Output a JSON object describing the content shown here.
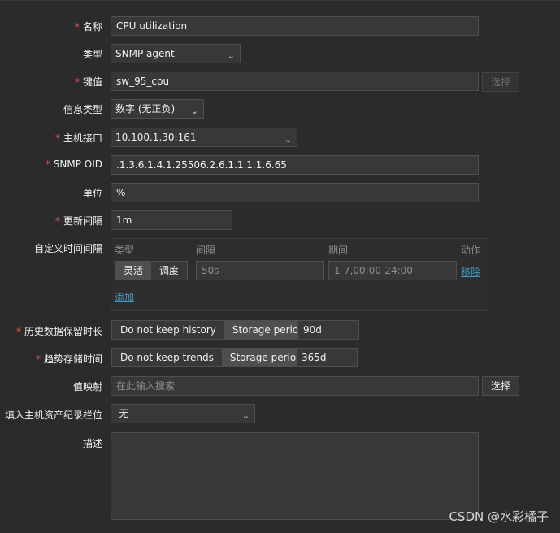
{
  "form": {
    "name": {
      "label": "名称",
      "value": "CPU utilization",
      "required": true
    },
    "type": {
      "label": "类型",
      "value": "SNMP agent"
    },
    "key": {
      "label": "键值",
      "value": "sw_95_cpu",
      "button": "选择",
      "required": true
    },
    "info_type": {
      "label": "信息类型",
      "value": "数字 (无正负)"
    },
    "host_interface": {
      "label": "主机接口",
      "value": "10.100.1.30:161",
      "required": true
    },
    "snmp_oid": {
      "label": "SNMP OID",
      "value": ".1.3.6.1.4.1.25506.2.6.1.1.1.1.6.65",
      "required": true
    },
    "units": {
      "label": "单位",
      "value": "%"
    },
    "update_interval": {
      "label": "更新间隔",
      "value": "1m",
      "required": true
    },
    "custom_intervals": {
      "label": "自定义时间间隔",
      "headers": {
        "type": "类型",
        "interval": "间隔",
        "period": "期间",
        "action": "动作"
      },
      "type_options": [
        "灵活",
        "调度"
      ],
      "interval_placeholder": "50s",
      "period_placeholder": "1-7,00:00-24:00",
      "remove": "移除",
      "add": "添加"
    },
    "history": {
      "label": "历史数据保留时长",
      "options": [
        "Do not keep history",
        "Storage period"
      ],
      "value": "90d",
      "required": true
    },
    "trends": {
      "label": "趋势存储时间",
      "options": [
        "Do not keep trends",
        "Storage period"
      ],
      "value": "365d",
      "required": true
    },
    "value_map": {
      "label": "值映射",
      "placeholder": "在此输入搜索",
      "button": "选择"
    },
    "inventory": {
      "label": "填入主机资产纪录栏位",
      "value": "-无-"
    },
    "description": {
      "label": "描述",
      "value": ""
    }
  },
  "watermark": "CSDN @水彩橘子",
  "icons": {
    "dropdown": "chevron-down-icon"
  },
  "colors": {
    "required": "#e45959",
    "link": "#4796c4",
    "background": "#2b2b2b"
  }
}
